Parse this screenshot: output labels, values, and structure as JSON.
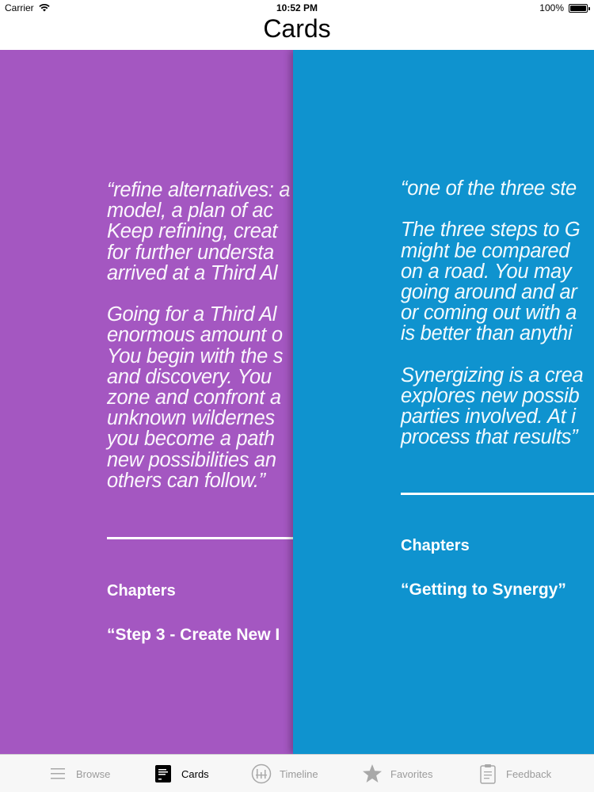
{
  "status_bar": {
    "carrier": "Carrier",
    "time": "10:52 PM",
    "battery": "100%",
    "battery_level": 1.0
  },
  "nav": {
    "title": "Cards"
  },
  "cards": [
    {
      "color": "#a457c1",
      "quote": "“refine alternatives: a\nmodel, a plan of ac\nKeep refining, creat\nfor further understa\narrived at a Third Al\n\nGoing for a Third Al\nenormous amount o\nYou begin with the s\nand discovery. You\nzone and confront a\nunknown wildernes\nyou become a path\nnew possibilities an\nothers can follow.”",
      "chapters_label": "Chapters",
      "chapter": "“Step 3 - Create New I"
    },
    {
      "color": "#0f93cf",
      "quote": "“one of the three ste\n\nThe three steps to G\nmight be compared\non a road. You may\ngoing around and ar\nor coming out with a\nis better than anythi\n\nSynergizing is a crea\nexplores new possib\nparties involved. At i\nprocess that results”",
      "chapters_label": "Chapters",
      "chapter": "“Getting to Synergy”"
    }
  ],
  "page_indicator": {
    "count": 2,
    "current": 1
  },
  "tabs": [
    {
      "label": "Browse",
      "icon": "list-icon",
      "selected": false
    },
    {
      "label": "Cards",
      "icon": "cards-icon",
      "selected": true
    },
    {
      "label": "Timeline",
      "icon": "timeline-icon",
      "selected": false
    },
    {
      "label": "Favorites",
      "icon": "star-icon",
      "selected": false
    },
    {
      "label": "Feedback",
      "icon": "clipboard-icon",
      "selected": false
    }
  ]
}
